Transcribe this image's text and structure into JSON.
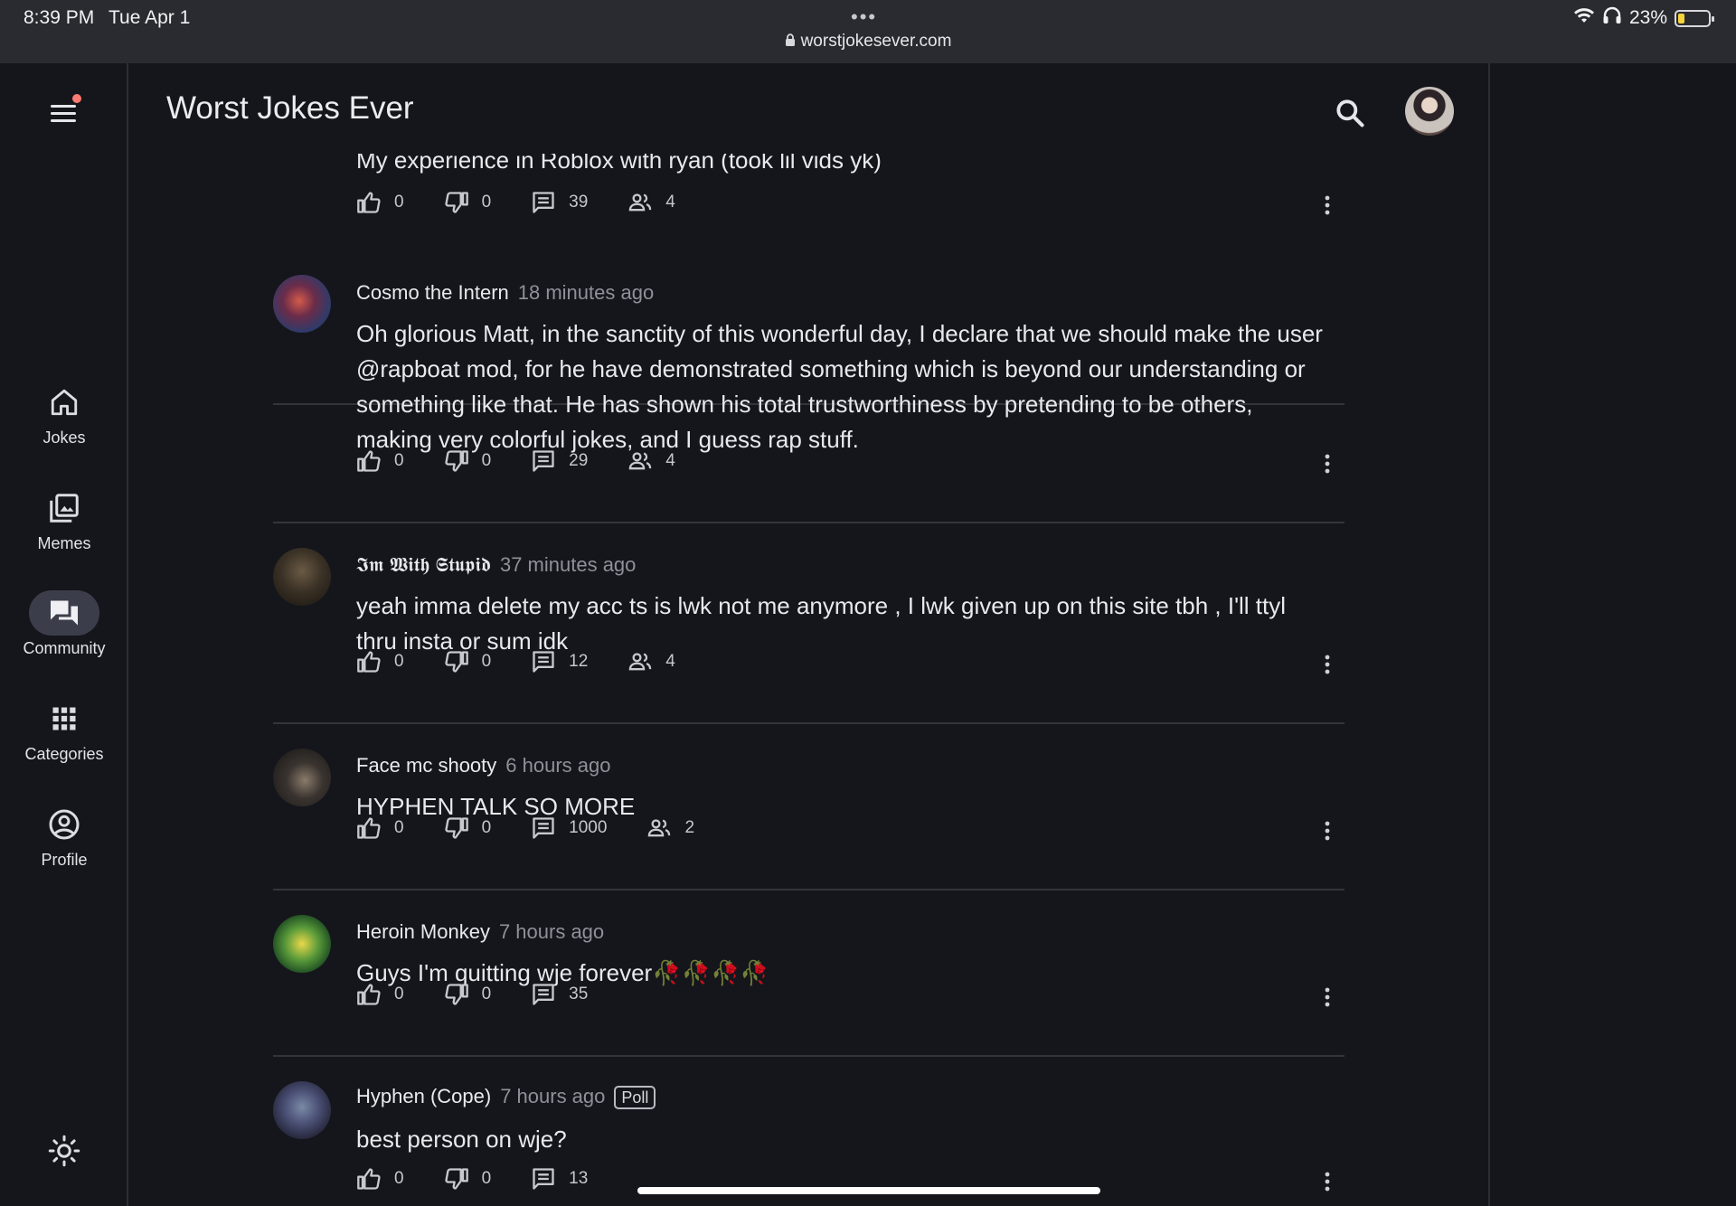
{
  "status_bar": {
    "time": "8:39 PM",
    "date": "Tue Apr 1",
    "url": "worstjokesever.com",
    "battery": "23%",
    "battery_level": 0.23
  },
  "header": {
    "title": "Worst Jokes Ever"
  },
  "nav": {
    "items": [
      {
        "label": "Jokes",
        "icon": "home-icon"
      },
      {
        "label": "Memes",
        "icon": "image-library-icon"
      },
      {
        "label": "Community",
        "icon": "forum-icon",
        "active": true
      },
      {
        "label": "Categories",
        "icon": "grid-icon"
      },
      {
        "label": "Profile",
        "icon": "account-circle-icon"
      }
    ]
  },
  "posts": [
    {
      "author": "",
      "time": "",
      "body": "My experience in Roblox with ryan (took lil vids yk)",
      "likes": "0",
      "dislikes": "0",
      "comments": "39",
      "participants": "4"
    },
    {
      "author": "Cosmo the Intern",
      "time": "18 minutes ago",
      "body": "Oh glorious Matt, in the sanctity of this wonderful day, I declare that we should make the user @rapboat mod, for he have demonstrated something which is beyond our understanding or something like that. He has shown his total trustworthiness by pretending to be others, making very colorful jokes, and I guess rap stuff.",
      "likes": "0",
      "dislikes": "0",
      "comments": "29",
      "participants": "4"
    },
    {
      "author": "𝕴𝖒 𝖂𝖎𝖙𝖍 𝕾𝖙𝖚𝖕𝖎𝖉",
      "time": "37 minutes ago",
      "body": "yeah imma delete my acc ts is lwk not me anymore , I lwk given up on this site tbh , I'll ttyl thru insta or sum idk",
      "likes": "0",
      "dislikes": "0",
      "comments": "12",
      "participants": "4"
    },
    {
      "author": "Face mc shooty",
      "time": "6 hours ago",
      "body": "HYPHEN TALK SO MORE",
      "likes": "0",
      "dislikes": "0",
      "comments": "1000",
      "participants": "2"
    },
    {
      "author": "Heroin Monkey",
      "time": "7 hours ago",
      "body": "Guys I'm quitting wje forever🥀🥀🥀🥀",
      "likes": "0",
      "dislikes": "0",
      "comments": "35"
    },
    {
      "author": "Hyphen (Cope)",
      "time": "7 hours ago",
      "badge": "Poll",
      "body": "best person on wje?",
      "likes": "0",
      "dislikes": "0",
      "comments": "13"
    }
  ]
}
